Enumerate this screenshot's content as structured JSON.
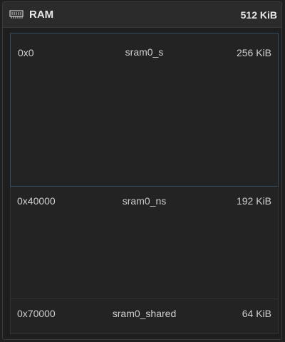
{
  "header": {
    "icon": "memory-chip-icon",
    "title": "RAM",
    "total_size": "512 KiB"
  },
  "regions": [
    {
      "address": "0x0",
      "name": "sram0_s",
      "size": "256 KiB",
      "selected": true
    },
    {
      "address": "0x40000",
      "name": "sram0_ns",
      "size": "192 KiB",
      "selected": false
    },
    {
      "address": "0x70000",
      "name": "sram0_shared",
      "size": "64 KiB",
      "selected": false
    }
  ],
  "colors": {
    "background": "#1e1e1e",
    "header_background": "#2b2b2b",
    "selection_border": "#2f4c63",
    "text": "#d4d4d4"
  }
}
